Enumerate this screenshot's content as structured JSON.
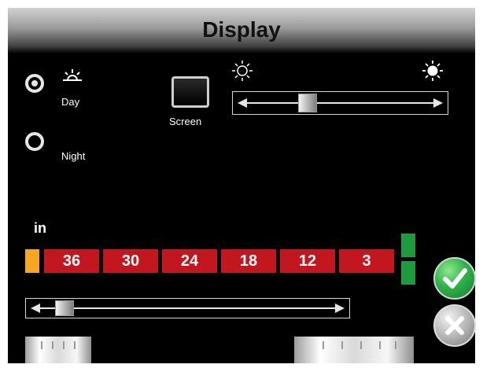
{
  "header": {
    "title": "Display"
  },
  "mode": {
    "day_label": "Day",
    "night_label": "Night",
    "selected": "Day"
  },
  "screen_button": {
    "label": "Screen"
  },
  "brightness": {
    "icon_low": "sun-outline-icon",
    "icon_high": "sun-filled-icon",
    "level": 0.3
  },
  "range": {
    "units_label": "in",
    "values": [
      "36",
      "30",
      "24",
      "18",
      "12",
      "3"
    ],
    "slider_level": 0.05
  },
  "colors": {
    "range_cell": "#c2171f",
    "left_marker": "#f5a623",
    "right_marker": "#1f9a3c",
    "accept": "#2fb24a"
  },
  "actions": {
    "accept_icon": "check-icon",
    "cancel_icon": "close-icon"
  }
}
